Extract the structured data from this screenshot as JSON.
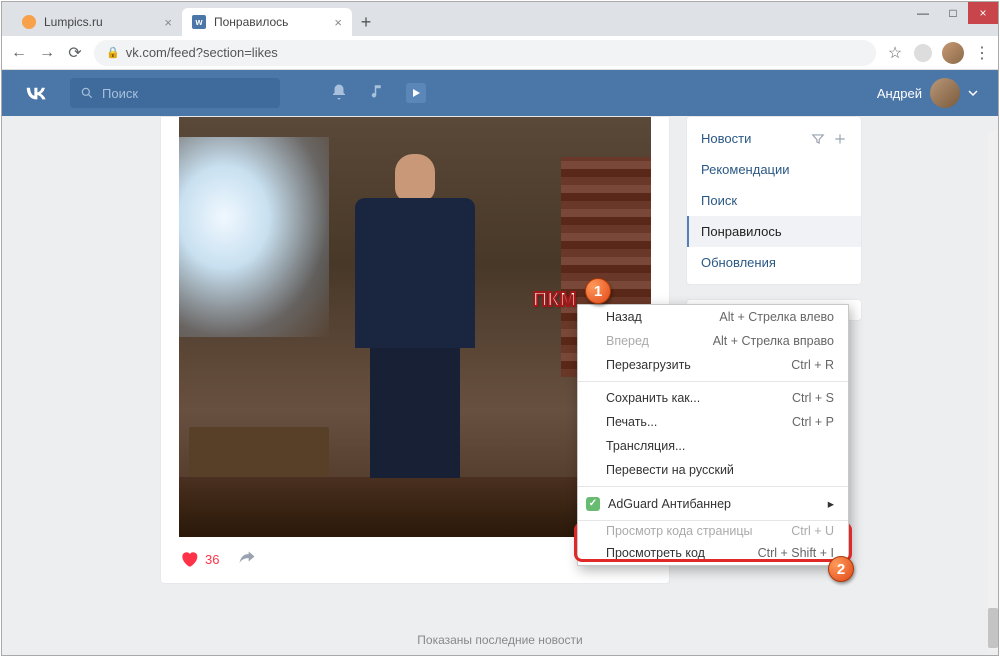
{
  "window": {
    "minimize": "—",
    "maximize": "□",
    "close": "×"
  },
  "tabs": [
    {
      "title": "Lumpics.ru"
    },
    {
      "title": "Понравилось",
      "fav": "w"
    }
  ],
  "newtab": "+",
  "nav": {
    "back": "←",
    "fwd": "→",
    "reload": "⟳",
    "lock": "🔒",
    "url": "vk.com/feed?section=likes",
    "star": "☆",
    "menu": "⋮"
  },
  "vk": {
    "search_placeholder": "Поиск",
    "user": "Андрей"
  },
  "sidebar": {
    "items": [
      {
        "label": "Новости"
      },
      {
        "label": "Рекомендации"
      },
      {
        "label": "Поиск"
      },
      {
        "label": "Понравилось"
      },
      {
        "label": "Обновления"
      }
    ]
  },
  "post": {
    "likes": "36"
  },
  "footer": "Показаны последние новости",
  "ctx": {
    "items": [
      {
        "label": "Назад",
        "sc": "Alt + Стрелка влево"
      },
      {
        "label": "Вперед",
        "sc": "Alt + Стрелка вправо"
      },
      {
        "label": "Перезагрузить",
        "sc": "Ctrl + R"
      }
    ],
    "items2": [
      {
        "label": "Сохранить как...",
        "sc": "Ctrl + S"
      },
      {
        "label": "Печать...",
        "sc": "Ctrl + P"
      },
      {
        "label": "Трансляция..."
      },
      {
        "label": "Перевести на русский"
      }
    ],
    "adguard": "AdGuard Антибаннер",
    "hidden": {
      "label": "Просмотр кода страницы",
      "sc": "Ctrl + U"
    },
    "inspect": {
      "label": "Просмотреть код",
      "sc": "Ctrl + Shift + I"
    }
  },
  "anno": {
    "pkm": "ПКМ",
    "one": "1",
    "two": "2",
    "arrow": "▸"
  }
}
